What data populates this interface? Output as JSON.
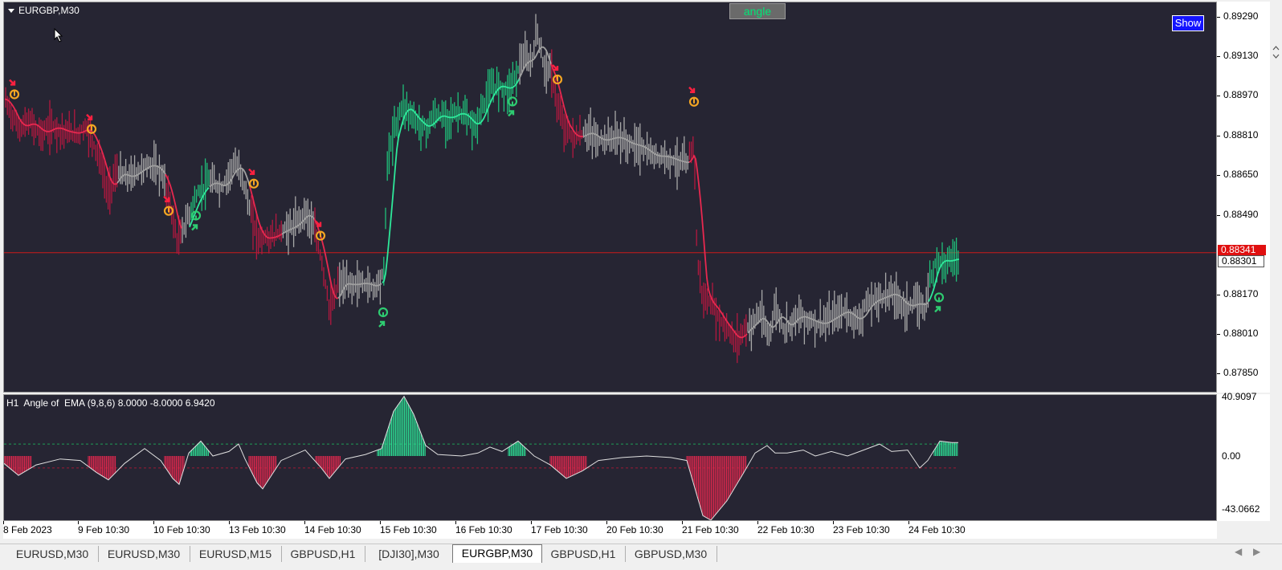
{
  "window": {
    "symbol_label": "EURGBP,M30",
    "angle_button": "angle",
    "show_button": "Show",
    "indicator_label": "H1  Angle of  EMA (9,8,6) 8.0000 -8.0000 6.9420"
  },
  "price_axis": {
    "ticks": [
      "0.89290",
      "0.89130",
      "0.88970",
      "0.88810",
      "0.88650",
      "0.88490",
      "0.88170",
      "0.88010",
      "0.87850"
    ],
    "bid_label": "0.88341",
    "current_label": "0.88301"
  },
  "indicator_axis": {
    "ticks": [
      "40.9097",
      "0.00",
      "-43.0662"
    ]
  },
  "time_axis": {
    "labels": [
      "8 Feb 2023",
      "9 Feb 10:30",
      "10 Feb 10:30",
      "13 Feb 10:30",
      "14 Feb 10:30",
      "15 Feb 10:30",
      "16 Feb 10:30",
      "17 Feb 10:30",
      "20 Feb 10:30",
      "21 Feb 10:30",
      "22 Feb 10:30",
      "23 Feb 10:30",
      "24 Feb 10:30"
    ]
  },
  "tabs": [
    {
      "label": "EURUSD,M30",
      "active": false
    },
    {
      "label": "EURUSD,M30",
      "active": false
    },
    {
      "label": "EURUSD,M15",
      "active": false
    },
    {
      "label": "GBPUSD,H1",
      "active": false
    },
    {
      "label": "[DJI30],M30",
      "active": false
    },
    {
      "label": "EURGBP,M30",
      "active": true
    },
    {
      "label": "GBPUSD,H1",
      "active": false
    },
    {
      "label": "GBPUSD,M30",
      "active": false
    }
  ],
  "colors": {
    "chart_bg": "#262533",
    "bull": "#1fbf7a",
    "bear": "#b3183f",
    "neutral": "#a8a8a8",
    "ema_up": "#2ee89a",
    "ema_down": "#e8284f",
    "ema_flat": "#a0a0a0",
    "bid_line": "#cc1b1b",
    "signal_orange": "#f5a623",
    "signal_green": "#2ecc71"
  },
  "chart_data": [
    {
      "type": "candlestick",
      "name": "EURGBP,M30",
      "ylim": [
        0.8778,
        0.8935
      ],
      "y_ticks": [
        0.8929,
        0.8913,
        0.8897,
        0.8881,
        0.8865,
        0.8849,
        0.8817,
        0.8801,
        0.8785
      ],
      "bid": 0.88341,
      "last": 0.88301,
      "x_labels": [
        "8 Feb 2023",
        "9 Feb 10:30",
        "10 Feb 10:30",
        "13 Feb 10:30",
        "14 Feb 10:30",
        "15 Feb 10:30",
        "16 Feb 10:30",
        "17 Feb 10:30",
        "20 Feb 10:30",
        "21 Feb 10:30",
        "22 Feb 10:30",
        "23 Feb 10:30",
        "24 Feb 10:30"
      ],
      "path_points": [
        [
          0,
          0.8896
        ],
        [
          8,
          0.889
        ],
        [
          18,
          0.8884
        ],
        [
          30,
          0.8887
        ],
        [
          45,
          0.8882
        ],
        [
          60,
          0.8885
        ],
        [
          72,
          0.8883
        ],
        [
          90,
          0.8882
        ],
        [
          100,
          0.8885
        ],
        [
          108,
          0.888
        ],
        [
          118,
          0.8872
        ],
        [
          128,
          0.8858
        ],
        [
          140,
          0.8867
        ],
        [
          152,
          0.8864
        ],
        [
          165,
          0.8867
        ],
        [
          180,
          0.887
        ],
        [
          195,
          0.8866
        ],
        [
          205,
          0.8855
        ],
        [
          215,
          0.8838
        ],
        [
          225,
          0.8846
        ],
        [
          240,
          0.8858
        ],
        [
          255,
          0.8863
        ],
        [
          270,
          0.886
        ],
        [
          285,
          0.887
        ],
        [
          295,
          0.8866
        ],
        [
          305,
          0.8851
        ],
        [
          315,
          0.884
        ],
        [
          330,
          0.884
        ],
        [
          345,
          0.8843
        ],
        [
          360,
          0.8845
        ],
        [
          375,
          0.8851
        ],
        [
          385,
          0.8843
        ],
        [
          395,
          0.883
        ],
        [
          405,
          0.881
        ],
        [
          415,
          0.8822
        ],
        [
          430,
          0.8821
        ],
        [
          445,
          0.8822
        ],
        [
          460,
          0.882
        ],
        [
          472,
          0.8826
        ],
        [
          476,
          0.887
        ],
        [
          485,
          0.8884
        ],
        [
          495,
          0.8894
        ],
        [
          505,
          0.889
        ],
        [
          515,
          0.8886
        ],
        [
          525,
          0.8884
        ],
        [
          535,
          0.889
        ],
        [
          550,
          0.8888
        ],
        [
          565,
          0.8891
        ],
        [
          575,
          0.8888
        ],
        [
          585,
          0.8884
        ],
        [
          595,
          0.8893
        ],
        [
          605,
          0.89
        ],
        [
          615,
          0.8902
        ],
        [
          625,
          0.8899
        ],
        [
          635,
          0.8905
        ],
        [
          645,
          0.8913
        ],
        [
          655,
          0.891
        ],
        [
          663,
          0.8924
        ],
        [
          670,
          0.891
        ],
        [
          680,
          0.8907
        ],
        [
          690,
          0.889
        ],
        [
          700,
          0.8883
        ],
        [
          710,
          0.888
        ],
        [
          725,
          0.8883
        ],
        [
          740,
          0.8879
        ],
        [
          760,
          0.8881
        ],
        [
          775,
          0.8878
        ],
        [
          790,
          0.8877
        ],
        [
          805,
          0.8873
        ],
        [
          820,
          0.8873
        ],
        [
          835,
          0.8871
        ],
        [
          850,
          0.887
        ],
        [
          858,
          0.888
        ],
        [
          862,
          0.883
        ],
        [
          870,
          0.8815
        ],
        [
          880,
          0.8813
        ],
        [
          890,
          0.8807
        ],
        [
          900,
          0.8803
        ],
        [
          910,
          0.8798
        ],
        [
          920,
          0.8803
        ],
        [
          930,
          0.8805
        ],
        [
          940,
          0.881
        ],
        [
          950,
          0.88
        ],
        [
          960,
          0.8812
        ],
        [
          970,
          0.8803
        ],
        [
          985,
          0.8809
        ],
        [
          1000,
          0.8807
        ],
        [
          1015,
          0.8805
        ],
        [
          1030,
          0.8808
        ],
        [
          1045,
          0.8811
        ],
        [
          1060,
          0.8806
        ],
        [
          1075,
          0.8814
        ],
        [
          1090,
          0.8816
        ],
        [
          1105,
          0.8818
        ],
        [
          1120,
          0.8812
        ],
        [
          1135,
          0.8814
        ],
        [
          1145,
          0.8812
        ],
        [
          1150,
          0.8821
        ],
        [
          1160,
          0.8832
        ],
        [
          1170,
          0.883
        ],
        [
          1180,
          0.8832
        ],
        [
          1188,
          0.8831
        ]
      ],
      "ema_segments": [
        {
          "trend": "down",
          "from": 0,
          "to": 108
        },
        {
          "trend": "down",
          "from": 108,
          "to": 140
        },
        {
          "trend": "flat",
          "from": 140,
          "to": 200
        },
        {
          "trend": "down",
          "from": 200,
          "to": 220
        },
        {
          "trend": "up",
          "from": 230,
          "to": 255
        },
        {
          "trend": "flat",
          "from": 255,
          "to": 305
        },
        {
          "trend": "down",
          "from": 305,
          "to": 345
        },
        {
          "trend": "flat",
          "from": 345,
          "to": 385
        },
        {
          "trend": "down",
          "from": 385,
          "to": 415
        },
        {
          "trend": "flat",
          "from": 415,
          "to": 470
        },
        {
          "trend": "up",
          "from": 470,
          "to": 640
        },
        {
          "trend": "flat",
          "from": 640,
          "to": 680
        },
        {
          "trend": "down",
          "from": 680,
          "to": 720
        },
        {
          "trend": "flat",
          "from": 720,
          "to": 852
        },
        {
          "trend": "down",
          "from": 852,
          "to": 925
        },
        {
          "trend": "flat",
          "from": 925,
          "to": 1150
        },
        {
          "trend": "up",
          "from": 1150,
          "to": 1188
        }
      ],
      "signals": [
        {
          "type": "sell",
          "x": 12,
          "price": 0.8896
        },
        {
          "type": "sell",
          "x": 108,
          "price": 0.8882
        },
        {
          "type": "sell",
          "x": 204,
          "price": 0.8849
        },
        {
          "type": "buy",
          "x": 238,
          "price": 0.8851
        },
        {
          "type": "sell",
          "x": 310,
          "price": 0.886
        },
        {
          "type": "sell",
          "x": 393,
          "price": 0.8839
        },
        {
          "type": "buy",
          "x": 471,
          "price": 0.8812
        },
        {
          "type": "buy",
          "x": 632,
          "price": 0.8897
        },
        {
          "type": "sell",
          "x": 688,
          "price": 0.8902
        },
        {
          "type": "sell",
          "x": 858,
          "price": 0.8893
        },
        {
          "type": "buy",
          "x": 1163,
          "price": 0.8818
        }
      ]
    },
    {
      "type": "histogram",
      "name": "H1 Angle of EMA (9,8,6)",
      "ylim": [
        -43.0662,
        40.9097
      ],
      "levels": [
        8.0,
        -8.0
      ],
      "bars": [
        {
          "from": 0,
          "to": 35,
          "peak": -12
        },
        {
          "from": 105,
          "to": 140,
          "peak": -16
        },
        {
          "from": 200,
          "to": 225,
          "peak": -18
        },
        {
          "from": 232,
          "to": 255,
          "peak": 11
        },
        {
          "from": 305,
          "to": 340,
          "peak": -22
        },
        {
          "from": 388,
          "to": 420,
          "peak": -16
        },
        {
          "from": 465,
          "to": 525,
          "peak": 40
        },
        {
          "from": 628,
          "to": 650,
          "peak": 11
        },
        {
          "from": 680,
          "to": 725,
          "peak": -15
        },
        {
          "from": 850,
          "to": 925,
          "peak": -43
        },
        {
          "from": 1158,
          "to": 1188,
          "peak": 10
        }
      ],
      "line": [
        [
          0,
          -5
        ],
        [
          18,
          -13
        ],
        [
          40,
          -6
        ],
        [
          70,
          -2
        ],
        [
          95,
          -3
        ],
        [
          115,
          -11
        ],
        [
          130,
          -16
        ],
        [
          150,
          -5
        ],
        [
          175,
          5
        ],
        [
          195,
          -3
        ],
        [
          210,
          -15
        ],
        [
          218,
          -19
        ],
        [
          230,
          2
        ],
        [
          245,
          10
        ],
        [
          260,
          0
        ],
        [
          280,
          3
        ],
        [
          292,
          8
        ],
        [
          300,
          -2
        ],
        [
          315,
          -18
        ],
        [
          322,
          -22
        ],
        [
          345,
          -3
        ],
        [
          375,
          4
        ],
        [
          395,
          -8
        ],
        [
          405,
          -15
        ],
        [
          425,
          -2
        ],
        [
          450,
          1
        ],
        [
          470,
          5
        ],
        [
          485,
          30
        ],
        [
          498,
          40
        ],
        [
          510,
          28
        ],
        [
          525,
          7
        ],
        [
          540,
          1
        ],
        [
          570,
          0
        ],
        [
          590,
          2
        ],
        [
          605,
          6
        ],
        [
          620,
          3
        ],
        [
          640,
          10
        ],
        [
          660,
          0
        ],
        [
          680,
          -6
        ],
        [
          700,
          -15
        ],
        [
          720,
          -10
        ],
        [
          740,
          -3
        ],
        [
          770,
          -1
        ],
        [
          800,
          0
        ],
        [
          830,
          -1
        ],
        [
          850,
          -3
        ],
        [
          870,
          -40
        ],
        [
          880,
          -43
        ],
        [
          900,
          -30
        ],
        [
          920,
          -12
        ],
        [
          935,
          2
        ],
        [
          950,
          7
        ],
        [
          960,
          2
        ],
        [
          975,
          2
        ],
        [
          995,
          4
        ],
        [
          1010,
          0
        ],
        [
          1030,
          3
        ],
        [
          1050,
          0
        ],
        [
          1070,
          4
        ],
        [
          1090,
          8
        ],
        [
          1105,
          3
        ],
        [
          1125,
          4
        ],
        [
          1140,
          -8
        ],
        [
          1150,
          -3
        ],
        [
          1165,
          10
        ],
        [
          1180,
          9
        ],
        [
          1188,
          9
        ]
      ]
    }
  ]
}
